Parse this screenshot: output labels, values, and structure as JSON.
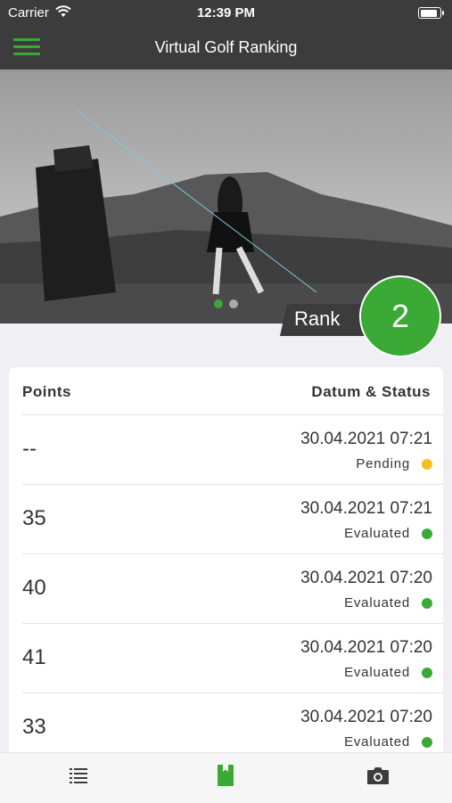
{
  "status_bar": {
    "carrier": "Carrier",
    "time": "12:39 PM",
    "battery_level": 1.0
  },
  "nav": {
    "title": "Virtual Golf Ranking",
    "menu_icon": "hamburger-icon"
  },
  "hero": {
    "image_desc": "golfer-photo",
    "page_indicator": {
      "total": 2,
      "current": 1
    }
  },
  "rank": {
    "label": "Rank",
    "value": "2"
  },
  "table": {
    "headers": {
      "points": "Points",
      "date_status": "Datum & Status"
    },
    "rows": [
      {
        "points": "--",
        "date": "30.04.2021 07:21",
        "status": "Pending",
        "status_color": "#f5c01d"
      },
      {
        "points": "35",
        "date": "30.04.2021 07:21",
        "status": "Evaluated",
        "status_color": "#3aa935"
      },
      {
        "points": "40",
        "date": "30.04.2021 07:20",
        "status": "Evaluated",
        "status_color": "#3aa935"
      },
      {
        "points": "41",
        "date": "30.04.2021 07:20",
        "status": "Evaluated",
        "status_color": "#3aa935"
      },
      {
        "points": "33",
        "date": "30.04.2021 07:20",
        "status": "Evaluated",
        "status_color": "#3aa935"
      }
    ]
  },
  "tabs": [
    {
      "icon": "list-icon",
      "active": false
    },
    {
      "icon": "scorecard-icon",
      "active": true
    },
    {
      "icon": "camera-icon",
      "active": false
    }
  ],
  "colors": {
    "accent": "#3aa935",
    "bar": "#3b3c3b",
    "pending": "#f5c01d"
  }
}
